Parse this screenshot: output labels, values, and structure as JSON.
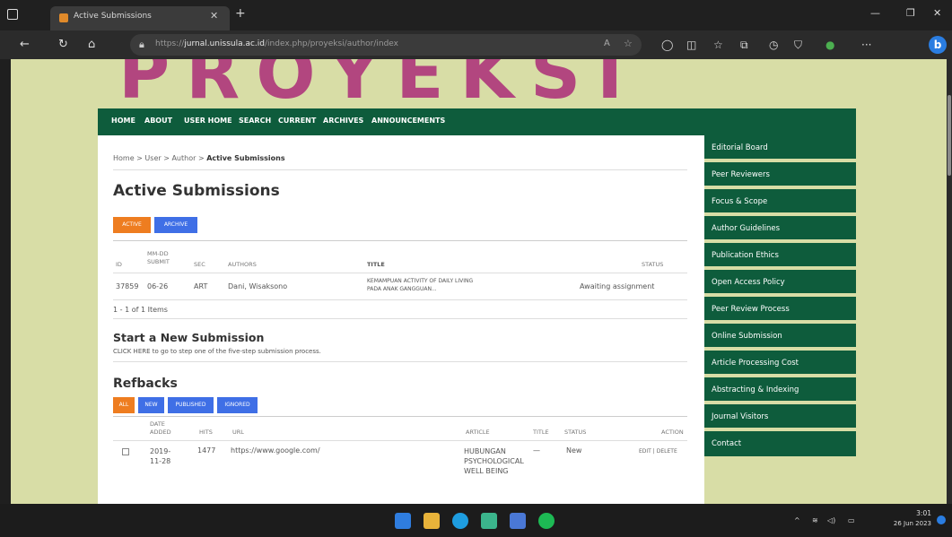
{
  "browser": {
    "tab_title": "Active Submissions",
    "url_prefix": "https://",
    "url_host": "jurnal.unissula.ac.id",
    "url_path": "/index.php/proyeksi/author/index"
  },
  "site": {
    "logo_text": "PROYEKSI"
  },
  "nav": [
    "HOME",
    "ABOUT",
    "USER HOME",
    "SEARCH",
    "CURRENT",
    "ARCHIVES",
    "ANNOUNCEMENTS"
  ],
  "breadcrumb": {
    "home": "Home",
    "user": "User",
    "author": "Author",
    "current": "Active Submissions",
    "sep": ">"
  },
  "title": "Active Submissions",
  "tabs": {
    "active": "ACTIVE",
    "archive": "ARCHIVE"
  },
  "submissions": {
    "headers": {
      "id": "ID",
      "date_l1": "MM-DD",
      "date_l2": "SUBMIT",
      "sec": "SEC",
      "authors": "AUTHORS",
      "title": "TITLE",
      "status": "STATUS"
    },
    "rows": [
      {
        "id": "37859",
        "date": "06-26",
        "sec": "ART",
        "authors": "Dani, Wisaksono",
        "title_l1": "KEMAMPUAN ACTIVITY OF DAILY LIVING",
        "title_l2": "PADA ANAK GANGGUAN...",
        "status": "Awaiting assignment"
      }
    ],
    "count": "1 - 1 of 1 Items"
  },
  "new_submission": {
    "heading": "Start a New Submission",
    "link": "CLICK HERE",
    "rest": "to go to step one of the five-step submission process."
  },
  "refbacks": {
    "heading": "Refbacks",
    "filters": [
      "ALL",
      "NEW",
      "PUBLISHED",
      "IGNORED"
    ],
    "headers": {
      "date_l1": "DATE",
      "date_l2": "ADDED",
      "hits": "HITS",
      "url": "URL",
      "article": "ARTICLE",
      "title": "TITLE",
      "status": "STATUS",
      "action": "ACTION"
    },
    "rows": [
      {
        "date_l1": "2019-",
        "date_l2": "11-28",
        "hits": "1477",
        "url": "https://www.google.com/",
        "article_l1": "HUBUNGAN",
        "article_l2": "PSYCHOLOGICAL",
        "article_l3": "WELL BEING",
        "title": "—",
        "status": "New",
        "edit": "EDIT",
        "delete": "DELETE",
        "sep": "|"
      }
    ]
  },
  "sidebar": [
    "Editorial Board",
    "Peer Reviewers",
    "Focus & Scope",
    "Author Guidelines",
    "Publication Ethics",
    "Open Access Policy",
    "Peer Review Process",
    "Online Submission",
    "Article Processing Cost",
    "Abstracting & Indexing",
    "Journal Visitors",
    "Contact"
  ],
  "system": {
    "time": "3:01",
    "date": "26 Jun 2023"
  },
  "colors": {
    "nav_green": "#0e5c3c",
    "accent_orange": "#ee7d20",
    "accent_blue": "#3f6fe6",
    "logo": "#b2467f",
    "page_bg": "#d8dda6"
  }
}
